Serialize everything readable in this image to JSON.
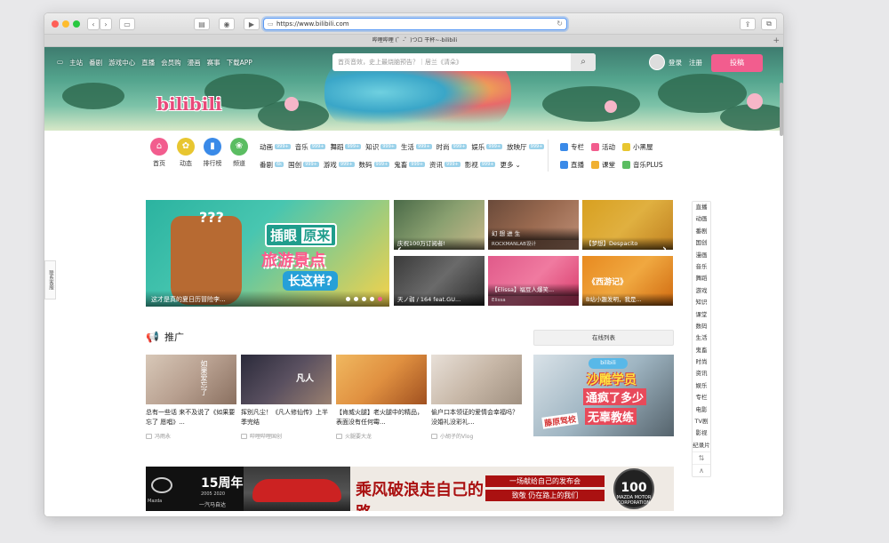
{
  "browser": {
    "url": "https://www.bilibili.com",
    "tab_title": "哔哩哔哩 (゜-゜)つロ 干杯~-bilibili",
    "toolbar_icons": [
      "back-icon",
      "forward-icon",
      "sidebar-icon",
      "shield-icon",
      "extension-icon",
      "media-icon",
      "share-icon",
      "tabs-icon"
    ]
  },
  "header": {
    "nav": [
      "主站",
      "番剧",
      "游戏中心",
      "直播",
      "会员购",
      "漫画",
      "赛事",
      "下载APP"
    ],
    "search_placeholder": "首页音效，史上最烧脑预告？｜居兰《清朵》",
    "login": "登录",
    "register": "注册",
    "submit": "投稿",
    "logo": "bilibili"
  },
  "quick_icons": [
    {
      "label": "首页",
      "color": "#f25d8e",
      "glyph": "⌂"
    },
    {
      "label": "动态",
      "color": "#e8c630",
      "glyph": "✿"
    },
    {
      "label": "排行榜",
      "color": "#3a8ae8",
      "glyph": "▮"
    },
    {
      "label": "频道",
      "color": "#5bbd62",
      "glyph": "❀"
    }
  ],
  "categories_row1": [
    {
      "name": "动画",
      "count": "999+"
    },
    {
      "name": "音乐",
      "count": "999+"
    },
    {
      "name": "舞蹈",
      "count": "999+"
    },
    {
      "name": "知识",
      "count": "999+"
    },
    {
      "name": "生活",
      "count": "999+"
    },
    {
      "name": "时尚",
      "count": "999+"
    },
    {
      "name": "娱乐",
      "count": "999+"
    },
    {
      "name": "放映厅",
      "count": "999+"
    }
  ],
  "categories_row2": [
    {
      "name": "番剧",
      "count": "6k"
    },
    {
      "name": "国创",
      "count": "999+"
    },
    {
      "name": "游戏",
      "count": "999+"
    },
    {
      "name": "数码",
      "count": "999+"
    },
    {
      "name": "鬼畜",
      "count": "999+"
    },
    {
      "name": "资讯",
      "count": "999+"
    },
    {
      "name": "影视",
      "count": "999+"
    },
    {
      "name": "更多",
      "count": ""
    }
  ],
  "extras": [
    {
      "label": "专栏",
      "color": "#3a8ae8"
    },
    {
      "label": "活动",
      "color": "#f25d8e"
    },
    {
      "label": "小黑屋",
      "color": "#e8c630"
    },
    {
      "label": "直播",
      "color": "#3a8ae8"
    },
    {
      "label": "课堂",
      "color": "#f0b030"
    },
    {
      "label": "音乐PLUS",
      "color": "#5bbd62"
    }
  ],
  "carousel": {
    "question": "???",
    "t1": "插眼",
    "t1b": "原来",
    "t2": "旅游景点",
    "t3": "长这样?",
    "caption": "这才是真的夏日历冒险李...",
    "dots": 5
  },
  "thumbs": [
    {
      "title": "庆祝100万订阅者!",
      "sub": "",
      "bg": "linear-gradient(135deg,#4a6a48,#8aa070,#c8b88a)"
    },
    {
      "title": "幻 想 进 生",
      "sub": "ROCKMANLAB设计",
      "bg": "linear-gradient(135deg,#6a4a3a,#9a6a50,#c09078)"
    },
    {
      "title": "【梦想】Despacito",
      "sub": "",
      "bg": "linear-gradient(135deg,#d8a020,#e0b040,#c08020)"
    },
    {
      "title": "天ノ弱 / 164 feat.GU...",
      "sub": "",
      "bg": "linear-gradient(135deg,#3a3a3a,#6a6a6a,#2a2a2a)"
    },
    {
      "title": "【Elissa】福豆人爆笑...",
      "sub": "Elissa",
      "bg": "linear-gradient(135deg,#e05a8a,#f07aa0,#d83a6a)"
    },
    {
      "title": "B站小趣发明，我是...",
      "sub": "《西游记》",
      "bg": "linear-gradient(135deg,#e88a20,#f0a840,#d06a10)"
    }
  ],
  "sidenav": {
    "top": "直播",
    "items": [
      "直播",
      "动画",
      "番剧",
      "国创",
      "漫画",
      "音乐",
      "舞蹈",
      "游戏",
      "知识",
      "课堂",
      "数码",
      "生活",
      "鬼畜",
      "时尚",
      "资讯",
      "娱乐",
      "专栏",
      "电影",
      "TV剧",
      "影视",
      "纪录片"
    ],
    "sort": "⇅",
    "up": "∧"
  },
  "feedback": "联系客服",
  "recommend": {
    "title": "推广",
    "online_list": "在线列表",
    "cards": [
      {
        "title": "总有一些话 来不及说了《如果要忘了 愿唱》...",
        "up": "冯雨永",
        "bg": "linear-gradient(135deg,#d8c8b8,#b8a090,#8a7060)",
        "img_text": "如果爱忘了"
      },
      {
        "title": "挥别凡尘！《凡人修仙传》上半季完结",
        "up": "哔哩哔哩国创",
        "bg": "linear-gradient(135deg,#2a2a3a,#5a5060,#9a8070)",
        "img_text": "凡人"
      },
      {
        "title": "【肯威火腿】老火腿中的精品，表面没有任何霉...",
        "up": "火腿要大龙",
        "bg": "linear-gradient(135deg,#f0b860,#e09040,#a05020)",
        "img_text": ""
      },
      {
        "title": "偷户口本领证的爱情会幸福吗？没婚礼没彩礼...",
        "up": "小胡子的Vlog",
        "bg": "linear-gradient(135deg,#e8e0d8,#c8b8a8,#a09080)",
        "img_text": ""
      }
    ]
  },
  "promo": {
    "p1": "bilibili",
    "p2": "沙雕学员",
    "p3": "通疯了多少",
    "p4": "无辜教练",
    "p5": "藤原驾校"
  },
  "ad": {
    "brand_small": "Mazda",
    "anniv": "15周年",
    "years": "2005 2020",
    "cn": "一汽马自达",
    "slogan": "乘风破浪走自己的路",
    "line1": "一场献给自己的发布会",
    "line2": "致敬 仍在路上的我们",
    "seal_big": "100",
    "seal_small": "MAZDA MOTOR CORPORATION"
  }
}
